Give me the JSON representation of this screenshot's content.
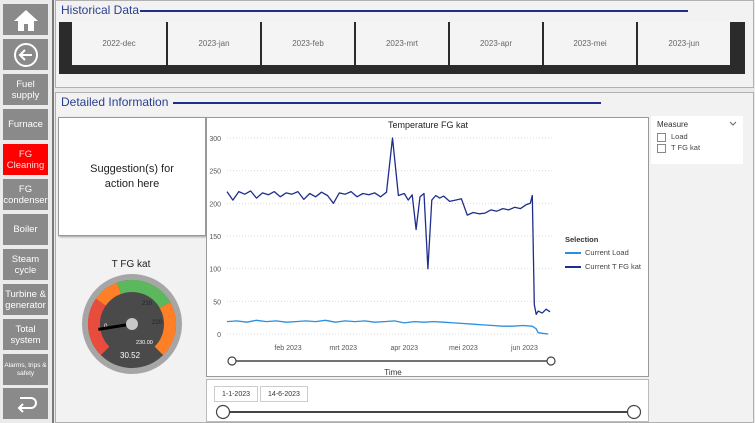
{
  "nav": {
    "items": [
      {
        "label": "Fuel supply"
      },
      {
        "label": "Furnace"
      },
      {
        "label": "FG Cleaning"
      },
      {
        "label": "FG condenser"
      },
      {
        "label": "Boiler"
      },
      {
        "label": "Steam cycle"
      },
      {
        "label": "Turbine & generator"
      },
      {
        "label": "Total system"
      },
      {
        "label": "Alarms, trips & safety"
      }
    ],
    "active_color": "#ff0000",
    "button_color": "#8a8a8a"
  },
  "historical": {
    "title": "Historical Data",
    "months": [
      "2022-dec",
      "2023-jan",
      "2023-feb",
      "2023-mrt",
      "2023-apr",
      "2023-mei",
      "2023-jun"
    ]
  },
  "detailed": {
    "title": "Detailed Information",
    "suggestion": "Suggestion(s) for action here"
  },
  "gauge": {
    "title": "T FG kat",
    "value_label": "30.52",
    "value": 30.52,
    "max_label": "230.00",
    "min": 0,
    "max": 230,
    "ticks": [
      "0",
      "210",
      "220"
    ],
    "zones": [
      "#e74c3c",
      "#ff7f27",
      "#5cb85c"
    ]
  },
  "measure": {
    "title": "Measure",
    "options": [
      "Load",
      "T FG kat"
    ]
  },
  "date_range": {
    "start": "1-1-2023",
    "end": "14-6-2023"
  },
  "chart_data": {
    "type": "line",
    "title": "Temperature FG kat",
    "xlabel": "Time",
    "ylabel": "",
    "ylim": [
      0,
      300
    ],
    "yticks": [
      0,
      50,
      100,
      150,
      200,
      250,
      300
    ],
    "xticks": [
      "feb 2023",
      "mrt 2023",
      "apr 2023",
      "mei 2023",
      "jun 2023"
    ],
    "xtick_days": [
      31,
      59,
      90,
      120,
      151
    ],
    "xlim_days": [
      0,
      165
    ],
    "legend_title": "Selection",
    "legend_position": "right",
    "grid": true,
    "series": [
      {
        "name": "Current Load",
        "color": "#2a8fe0",
        "x_days": [
          0,
          5,
          10,
          15,
          20,
          25,
          30,
          35,
          40,
          45,
          50,
          55,
          60,
          65,
          70,
          75,
          80,
          85,
          90,
          95,
          100,
          105,
          110,
          115,
          120,
          125,
          130,
          135,
          140,
          145,
          150,
          155,
          157,
          158,
          160,
          163
        ],
        "values": [
          19,
          20,
          18,
          21,
          19,
          20,
          18,
          19,
          20,
          19,
          21,
          18,
          20,
          19,
          20,
          18,
          19,
          20,
          17,
          19,
          18,
          19,
          18,
          17,
          16,
          15,
          14,
          13,
          12,
          12,
          13,
          12,
          8,
          2,
          1,
          0
        ]
      },
      {
        "name": "Current T FG kat",
        "color": "#1f2e8c",
        "x_days": [
          0,
          3,
          6,
          9,
          12,
          15,
          18,
          21,
          24,
          27,
          30,
          33,
          36,
          39,
          42,
          45,
          48,
          51,
          54,
          57,
          60,
          63,
          66,
          69,
          72,
          75,
          78,
          81,
          84,
          87,
          90,
          92,
          94,
          96,
          98,
          100,
          102,
          104,
          106,
          108,
          110,
          113,
          116,
          119,
          122,
          125,
          128,
          131,
          134,
          137,
          140,
          143,
          146,
          149,
          152,
          154,
          155,
          156,
          157,
          158,
          160,
          162,
          164
        ],
        "values": [
          218,
          205,
          218,
          214,
          219,
          208,
          216,
          213,
          218,
          210,
          216,
          214,
          218,
          206,
          215,
          210,
          217,
          212,
          200,
          216,
          214,
          218,
          210,
          215,
          213,
          216,
          210,
          217,
          300,
          212,
          215,
          205,
          213,
          160,
          210,
          215,
          100,
          205,
          212,
          208,
          211,
          203,
          205,
          207,
          182,
          186,
          184,
          185,
          190,
          188,
          192,
          190,
          194,
          192,
          198,
          200,
          212,
          45,
          30,
          35,
          32,
          38,
          34
        ]
      }
    ]
  }
}
